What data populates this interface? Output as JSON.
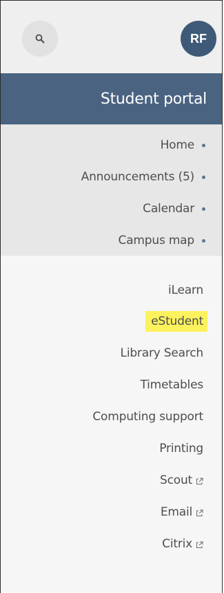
{
  "header": {
    "search_icon": "search-icon",
    "avatar_initials": "RF",
    "title": "Student portal"
  },
  "primary_nav": [
    {
      "label": "Home"
    },
    {
      "label": "Announcements (5)"
    },
    {
      "label": "Calendar"
    },
    {
      "label": "Campus map"
    }
  ],
  "secondary_nav": [
    {
      "label": "iLearn",
      "external": false
    },
    {
      "label": "eStudent",
      "external": false,
      "highlighted": true
    },
    {
      "label": "Library Search",
      "external": false
    },
    {
      "label": "Timetables",
      "external": false
    },
    {
      "label": "Computing support",
      "external": false
    },
    {
      "label": "Printing",
      "external": false
    },
    {
      "label": "Scout",
      "external": true
    },
    {
      "label": "Email",
      "external": true
    },
    {
      "label": "Citrix",
      "external": true
    }
  ],
  "colors": {
    "header_bg": "#4a6380",
    "avatar_bg": "#3e5a78",
    "highlight": "#fbf25d",
    "bullet": "#5d7592"
  }
}
